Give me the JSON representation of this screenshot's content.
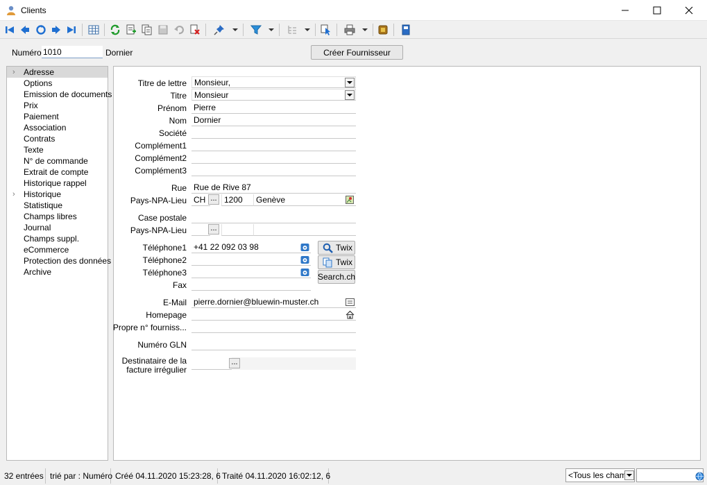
{
  "window": {
    "title": "Clients"
  },
  "toolbar": {
    "icons": [
      "first-record-icon",
      "prev-record-icon",
      "refresh-nav-icon",
      "next-record-icon",
      "last-record-icon",
      "table-view-icon",
      "reload-icon",
      "new-record-icon",
      "copy-record-icon",
      "save-icon",
      "undo-icon",
      "delete-icon",
      "pin-icon",
      "filter-icon",
      "tree-icon",
      "select-cursor-icon",
      "print-icon",
      "addon-icon",
      "export-icon"
    ]
  },
  "header": {
    "numero_label": "Numéro",
    "numero_value": "1010",
    "name": "Dornier",
    "create_supplier_button": "Créer Fournisseur"
  },
  "sidebar": {
    "items": [
      {
        "label": "Adresse",
        "selected": true,
        "expandable": true
      },
      {
        "label": "Options"
      },
      {
        "label": "Emission de documents"
      },
      {
        "label": "Prix"
      },
      {
        "label": "Paiement"
      },
      {
        "label": "Association"
      },
      {
        "label": "Contrats"
      },
      {
        "label": "Texte"
      },
      {
        "label": "N° de commande"
      },
      {
        "label": "Extrait de compte"
      },
      {
        "label": "Historique rappel"
      },
      {
        "label": "Historique",
        "expandable": true
      },
      {
        "label": "Statistique"
      },
      {
        "label": "Champs libres"
      },
      {
        "label": "Journal"
      },
      {
        "label": "Champs suppl."
      },
      {
        "label": "eCommerce"
      },
      {
        "label": "Protection des données"
      },
      {
        "label": "Archive"
      }
    ]
  },
  "form": {
    "titre_lettre": {
      "label": "Titre de lettre",
      "value": "Monsieur,"
    },
    "titre": {
      "label": "Titre",
      "value": "Monsieur"
    },
    "prenom": {
      "label": "Prénom",
      "value": "Pierre"
    },
    "nom": {
      "label": "Nom",
      "value": "Dornier"
    },
    "societe": {
      "label": "Société",
      "value": ""
    },
    "complement1": {
      "label": "Complément1",
      "value": ""
    },
    "complement2": {
      "label": "Complément2",
      "value": ""
    },
    "complement3": {
      "label": "Complément3",
      "value": ""
    },
    "rue": {
      "label": "Rue",
      "value": "Rue de Rive 87"
    },
    "pays_npa_lieu": {
      "label": "Pays-NPA-Lieu",
      "pays": "CH",
      "npa": "1200",
      "lieu": "Genève"
    },
    "case_postale": {
      "label": "Case postale",
      "value": ""
    },
    "pays_npa_lieu2": {
      "label": "Pays-NPA-Lieu",
      "pays": "",
      "npa": "",
      "lieu": ""
    },
    "telephone1": {
      "label": "Téléphone1",
      "value": "+41 22 092 03 98"
    },
    "telephone2": {
      "label": "Téléphone2",
      "value": ""
    },
    "telephone3": {
      "label": "Téléphone3",
      "value": ""
    },
    "fax": {
      "label": "Fax",
      "value": ""
    },
    "email": {
      "label": "E-Mail",
      "value": "pierre.dornier@bluewin-muster.ch"
    },
    "homepage": {
      "label": "Homepage",
      "value": ""
    },
    "propre_no": {
      "label": "Propre n° fourniss...",
      "value": ""
    },
    "gln": {
      "label": "Numéro GLN",
      "value": ""
    },
    "destinataire": {
      "label_line1": "Destinataire de la",
      "label_line2": "facture irrégulier",
      "value": ""
    },
    "ellipsis": "...",
    "twix1": "Twix",
    "twix2": "Twix",
    "searchch": "Search.ch"
  },
  "status": {
    "entries": "32 entrées",
    "sorted": "trié par : Numéro",
    "created": "Créé 04.11.2020 15:23:28,  6",
    "modified": "Traité 04.11.2020 16:02:12,  6",
    "field_filter": "<Tous les champs>"
  }
}
